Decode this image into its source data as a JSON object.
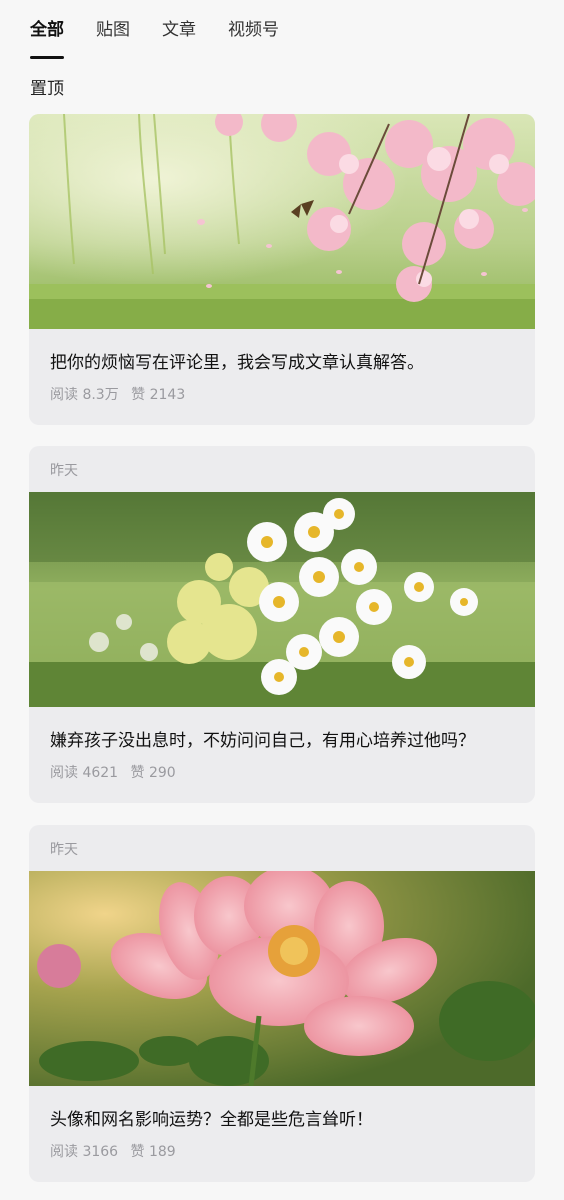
{
  "tabs": [
    {
      "label": "全部",
      "active": true
    },
    {
      "label": "贴图",
      "active": false
    },
    {
      "label": "文章",
      "active": false
    },
    {
      "label": "视频号",
      "active": false
    }
  ],
  "pinned_section": {
    "title": "置顶"
  },
  "articles": [
    {
      "date": "",
      "title": "把你的烦恼写在评论里，我会写成文章认真解答。",
      "reads": "阅读 8.3万",
      "likes": "赞 2143",
      "image_icon": "cherry-blossom-butterfly-photo"
    },
    {
      "date": "昨天",
      "title": "嫌弃孩子没出息时，不妨问问自己，有用心培养过他吗？",
      "reads": "阅读 4621",
      "likes": "赞 290",
      "image_icon": "daisy-bouquet-photo"
    },
    {
      "date": "昨天",
      "title": "头像和网名影响运势？全都是些危言耸听！",
      "reads": "阅读 3166",
      "likes": "赞 189",
      "image_icon": "pink-peony-photo"
    }
  ]
}
